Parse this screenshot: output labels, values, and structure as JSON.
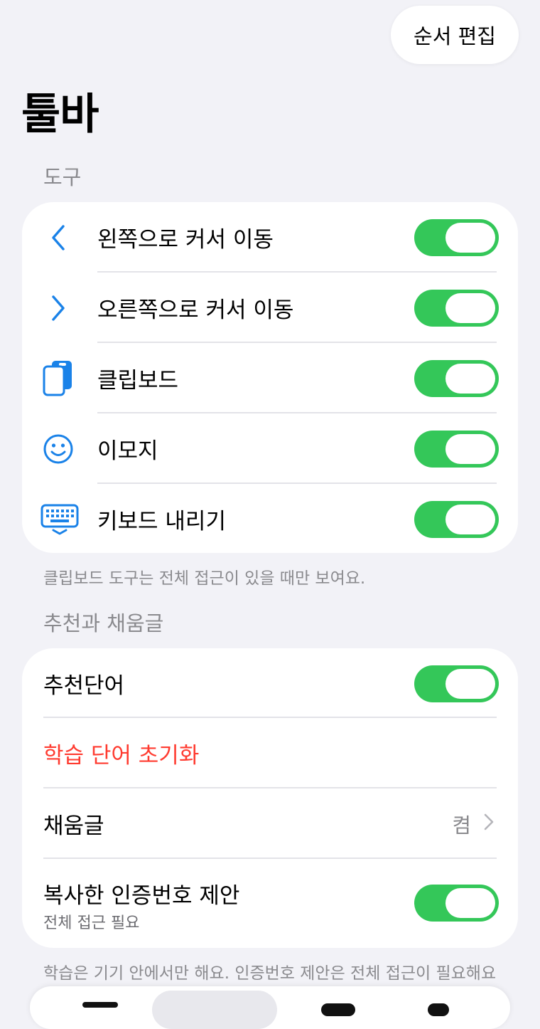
{
  "header": {
    "edit_order_label": "순서 편집",
    "title": "툴바"
  },
  "tools_section": {
    "header": "도구",
    "items": [
      {
        "icon": "chevron-left-icon",
        "label": "왼쪽으로 커서 이동",
        "enabled": true
      },
      {
        "icon": "chevron-right-icon",
        "label": "오른쪽으로 커서 이동",
        "enabled": true
      },
      {
        "icon": "clipboard-icon",
        "label": "클립보드",
        "enabled": true
      },
      {
        "icon": "smiley-icon",
        "label": "이모지",
        "enabled": true
      },
      {
        "icon": "keyboard-dismiss-icon",
        "label": "키보드 내리기",
        "enabled": true
      }
    ],
    "footnote": "클립보드 도구는 전체 접근이 있을 때만 보여요."
  },
  "suggest_section": {
    "header": "추천과 채움글",
    "items": [
      {
        "label": "추천단어",
        "enabled": true
      },
      {
        "label": "학습 단어 초기화",
        "color": "#ff3b30"
      },
      {
        "label": "채움글",
        "value": "켬"
      },
      {
        "label": "복사한 인증번호 제안",
        "sublabel": "전체 접근 필요",
        "enabled": true
      }
    ],
    "footnote": "학습은 기기 안에서만 해요. 인증번호 제안은 전체 접근이 필요해요"
  },
  "colors": {
    "accent": "#1a82e8",
    "toggle_on": "#34c759",
    "destructive": "#ff3b30"
  }
}
